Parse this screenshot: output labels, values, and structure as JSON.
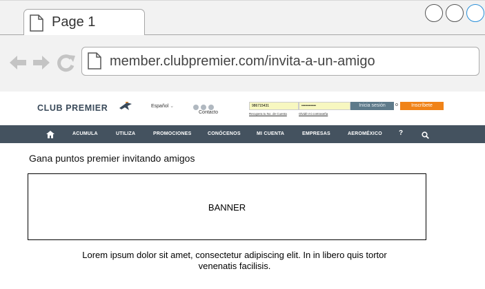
{
  "browser": {
    "tab_title": "Page 1",
    "url": "member.clubpremier.com/invita-a-un-amigo"
  },
  "site": {
    "logo_text": "CLUB PREMIER",
    "language": "Español",
    "contact_label": "Contacto",
    "login": {
      "user_value": "986715431",
      "password_value": "••••••••••••",
      "login_button": "Inicia sesión",
      "or_text": "o",
      "signup_button": "Inscríbete",
      "recover_link": "Recupera tu No. de Cuenta",
      "forgot_link": "Olvidé mi contraseña"
    },
    "nav": {
      "items": [
        "ACUMULA",
        "UTILIZA",
        "PROMOCIONES",
        "CONÓCENOS",
        "MI CUENTA",
        "EMPRESAS",
        "AEROMÉXICO"
      ],
      "help": "?"
    }
  },
  "main": {
    "heading": "Gana puntos premier invitando amigos",
    "banner_label": "BANNER",
    "description": "Lorem ipsum dolor sit amet, consectetur adipiscing elit. In in libero quis tortor venenatis facilisis."
  },
  "colors": {
    "navbar": "#44525f",
    "login_button": "#5e7a8a",
    "signup_button": "#f08318",
    "input_fill": "#f7f7c0"
  }
}
